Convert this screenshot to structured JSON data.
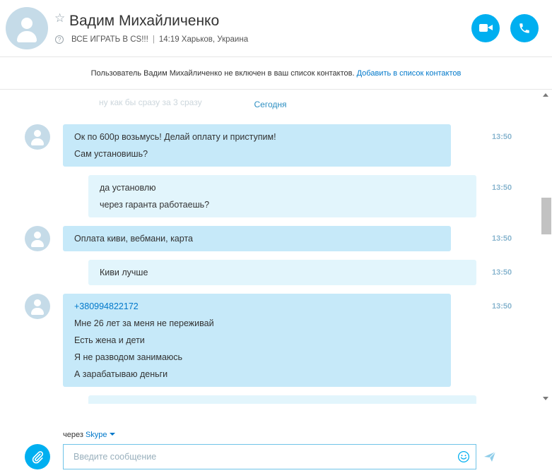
{
  "header": {
    "contact_name": "Вадим Михайличенко",
    "mood": "ВСЕ ИГРАТЬ В CS!!!",
    "separator": "|",
    "local_time_location": "14:19 Харьков, Украина",
    "icons": [
      "avatar",
      "star-icon",
      "question-icon",
      "video-call-icon",
      "audio-call-icon"
    ]
  },
  "banner": {
    "text": "Пользователь Вадим Михайличенко не включен в ваш список контактов.",
    "link": "Добавить в список контактов"
  },
  "conversation": {
    "faded_previous_text": "ну как бы сразу за 3 сразу",
    "date_divider": "Сегодня",
    "messages": [
      {
        "direction": "incoming",
        "lines": [
          "Ок по 600р возьмусь! Делай оплату и приступим!",
          "Сам установишь?"
        ],
        "time": "13:50"
      },
      {
        "direction": "outgoing",
        "lines": [
          "да установлю",
          "через гаранта работаешь?"
        ],
        "time": "13:50"
      },
      {
        "direction": "incoming",
        "lines": [
          "Оплата киви, вебмани, карта"
        ],
        "time": "13:50"
      },
      {
        "direction": "outgoing",
        "lines": [
          "Киви лучше"
        ],
        "time": "13:50"
      },
      {
        "direction": "incoming",
        "lines": [
          "+380994822172",
          "Мне 26 лет за меня не переживай",
          "Есть жена и дети",
          "Я не разводом занимаюсь",
          "А зарабатываю деньги"
        ],
        "time": "13:50"
      }
    ]
  },
  "composer": {
    "via_label": "через",
    "via_service": "Skype",
    "placeholder": "Введите сообщение"
  },
  "colors": {
    "accent": "#00aff0",
    "incoming_bubble": "#c6e9f9",
    "outgoing_bubble": "#e2f5fc",
    "link": "#0078ca"
  }
}
